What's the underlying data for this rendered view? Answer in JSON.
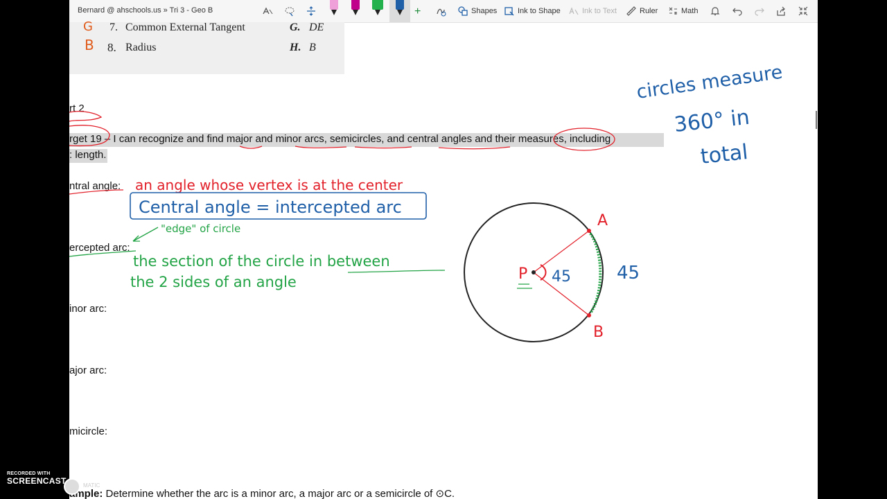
{
  "toolbar": {
    "title": "Bernard @ ahschools.us » Tri 3 - Geo B",
    "shapes": "Shapes",
    "ink_to_shape": "Ink to Shape",
    "ink_to_text": "Ink to Text",
    "ruler": "Ruler",
    "math": "Math",
    "pen_colors": [
      "#f0a0d8",
      "#c0008a",
      "#22b14c",
      "#1f5fa8"
    ]
  },
  "matching": [
    {
      "answer": "G",
      "num": "7.",
      "term": "Common External Tangent",
      "letter": "G.",
      "def": "DE"
    },
    {
      "answer": "B",
      "num": "8.",
      "term": "Radius",
      "letter": "H.",
      "def": "B"
    }
  ],
  "doc": {
    "part": "rt 2",
    "target_prefix": "rget 19",
    "target_text": " – I can recognize and find major and minor arcs, semicircles, and central angles and their measures, including",
    "target_text2": ": length.",
    "central_angle": "ntral angle:",
    "intercepted_arc": "ercepted arc:",
    "minor_arc": "inor arc:",
    "major_arc": "ajor arc:",
    "semicircle": "micircle:",
    "example_label": "ample:",
    "example_text": " Determine whether the arc is a minor arc, a major arc or a semicircle of ⊙C."
  },
  "ink": {
    "red_def": "an angle whose vertex is at the center",
    "boxed": "Central angle = intercepted arc",
    "edge": "\"edge\" of circle",
    "green1": "the section of the circle  in between",
    "green2": "the 2 sides of an angle",
    "circles1": "circles measure",
    "circles2": "360°  in",
    "circles3": "total",
    "label_p": "P",
    "label_a": "A",
    "label_b": "B",
    "angle_val": "45",
    "arc_val": "45"
  },
  "watermark": {
    "recorded": "RECORDED WITH",
    "brand": "SCREENCAST",
    "matic": "MATIC"
  }
}
